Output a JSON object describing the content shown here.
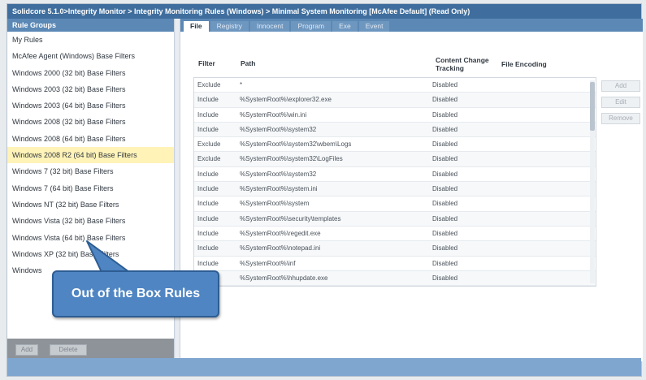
{
  "window": {
    "title": "Solidcore 5.1.0>Integrity Monitor > Integrity Monitoring Rules (Windows) > Minimal System Monitoring [McAfee Default] (Read Only)"
  },
  "left_panel": {
    "header": "Rule Groups",
    "items": [
      "My Rules",
      "McAfee Agent (Windows) Base Filters",
      "Windows 2000 (32 bit) Base Filters",
      "Windows 2003 (32 bit) Base Filters",
      "Windows 2003 (64 bit) Base Filters",
      "Windows 2008 (32 bit) Base Filters",
      "Windows 2008 (64 bit) Base Filters",
      "Windows 2008 R2 (64 bit) Base Filters",
      "Windows 7 (32 bit) Base Filters",
      "Windows 7 (64 bit) Base Filters",
      "Windows NT (32 bit) Base Filters",
      "Windows Vista (32 bit) Base Filters",
      "Windows Vista (64 bit) Base Filters",
      "Windows XP (32 bit) Base Filters",
      "Windows"
    ],
    "selected_index": 7,
    "buttons": {
      "add": "Add",
      "delete": "Delete"
    }
  },
  "tabs": [
    "File",
    "Registry",
    "Innocent",
    "Program",
    "Exe",
    "Event"
  ],
  "active_tab": 0,
  "columns": {
    "filter": "Filter",
    "path": "Path",
    "content_change": "Content Change Tracking",
    "file_encoding": "File Encoding"
  },
  "rows": [
    {
      "filter": "Exclude",
      "path": "*",
      "change": "Disabled"
    },
    {
      "filter": "Include",
      "path": "%SystemRoot%\\explorer32.exe",
      "change": "Disabled"
    },
    {
      "filter": "Include",
      "path": "%SystemRoot%\\win.ini",
      "change": "Disabled"
    },
    {
      "filter": "Include",
      "path": "%SystemRoot%\\system32",
      "change": "Disabled"
    },
    {
      "filter": "Exclude",
      "path": "%SystemRoot%\\system32\\wbem\\Logs",
      "change": "Disabled"
    },
    {
      "filter": "Exclude",
      "path": "%SystemRoot%\\system32\\LogFiles",
      "change": "Disabled"
    },
    {
      "filter": "Include",
      "path": "%SystemRoot%\\system32",
      "change": "Disabled"
    },
    {
      "filter": "Include",
      "path": "%SystemRoot%\\system.ini",
      "change": "Disabled"
    },
    {
      "filter": "Include",
      "path": "%SystemRoot%\\system",
      "change": "Disabled"
    },
    {
      "filter": "Include",
      "path": "%SystemRoot%\\security\\templates",
      "change": "Disabled"
    },
    {
      "filter": "Include",
      "path": "%SystemRoot%\\regedit.exe",
      "change": "Disabled"
    },
    {
      "filter": "Include",
      "path": "%SystemRoot%\\notepad.ini",
      "change": "Disabled"
    },
    {
      "filter": "Include",
      "path": "%SystemRoot%\\inf",
      "change": "Disabled"
    },
    {
      "filter": "Include",
      "path": "%SystemRoot%\\hhupdate.exe",
      "change": "Disabled"
    }
  ],
  "right_buttons": {
    "add": "Add",
    "edit": "Edit",
    "remove": "Remove"
  },
  "callout": "Out of the Box Rules",
  "colors": {
    "accent": "#5b88b5",
    "titlebar": "#3f6e9e",
    "selected_row": "#fff3b8",
    "callout": "#4f85c2"
  }
}
